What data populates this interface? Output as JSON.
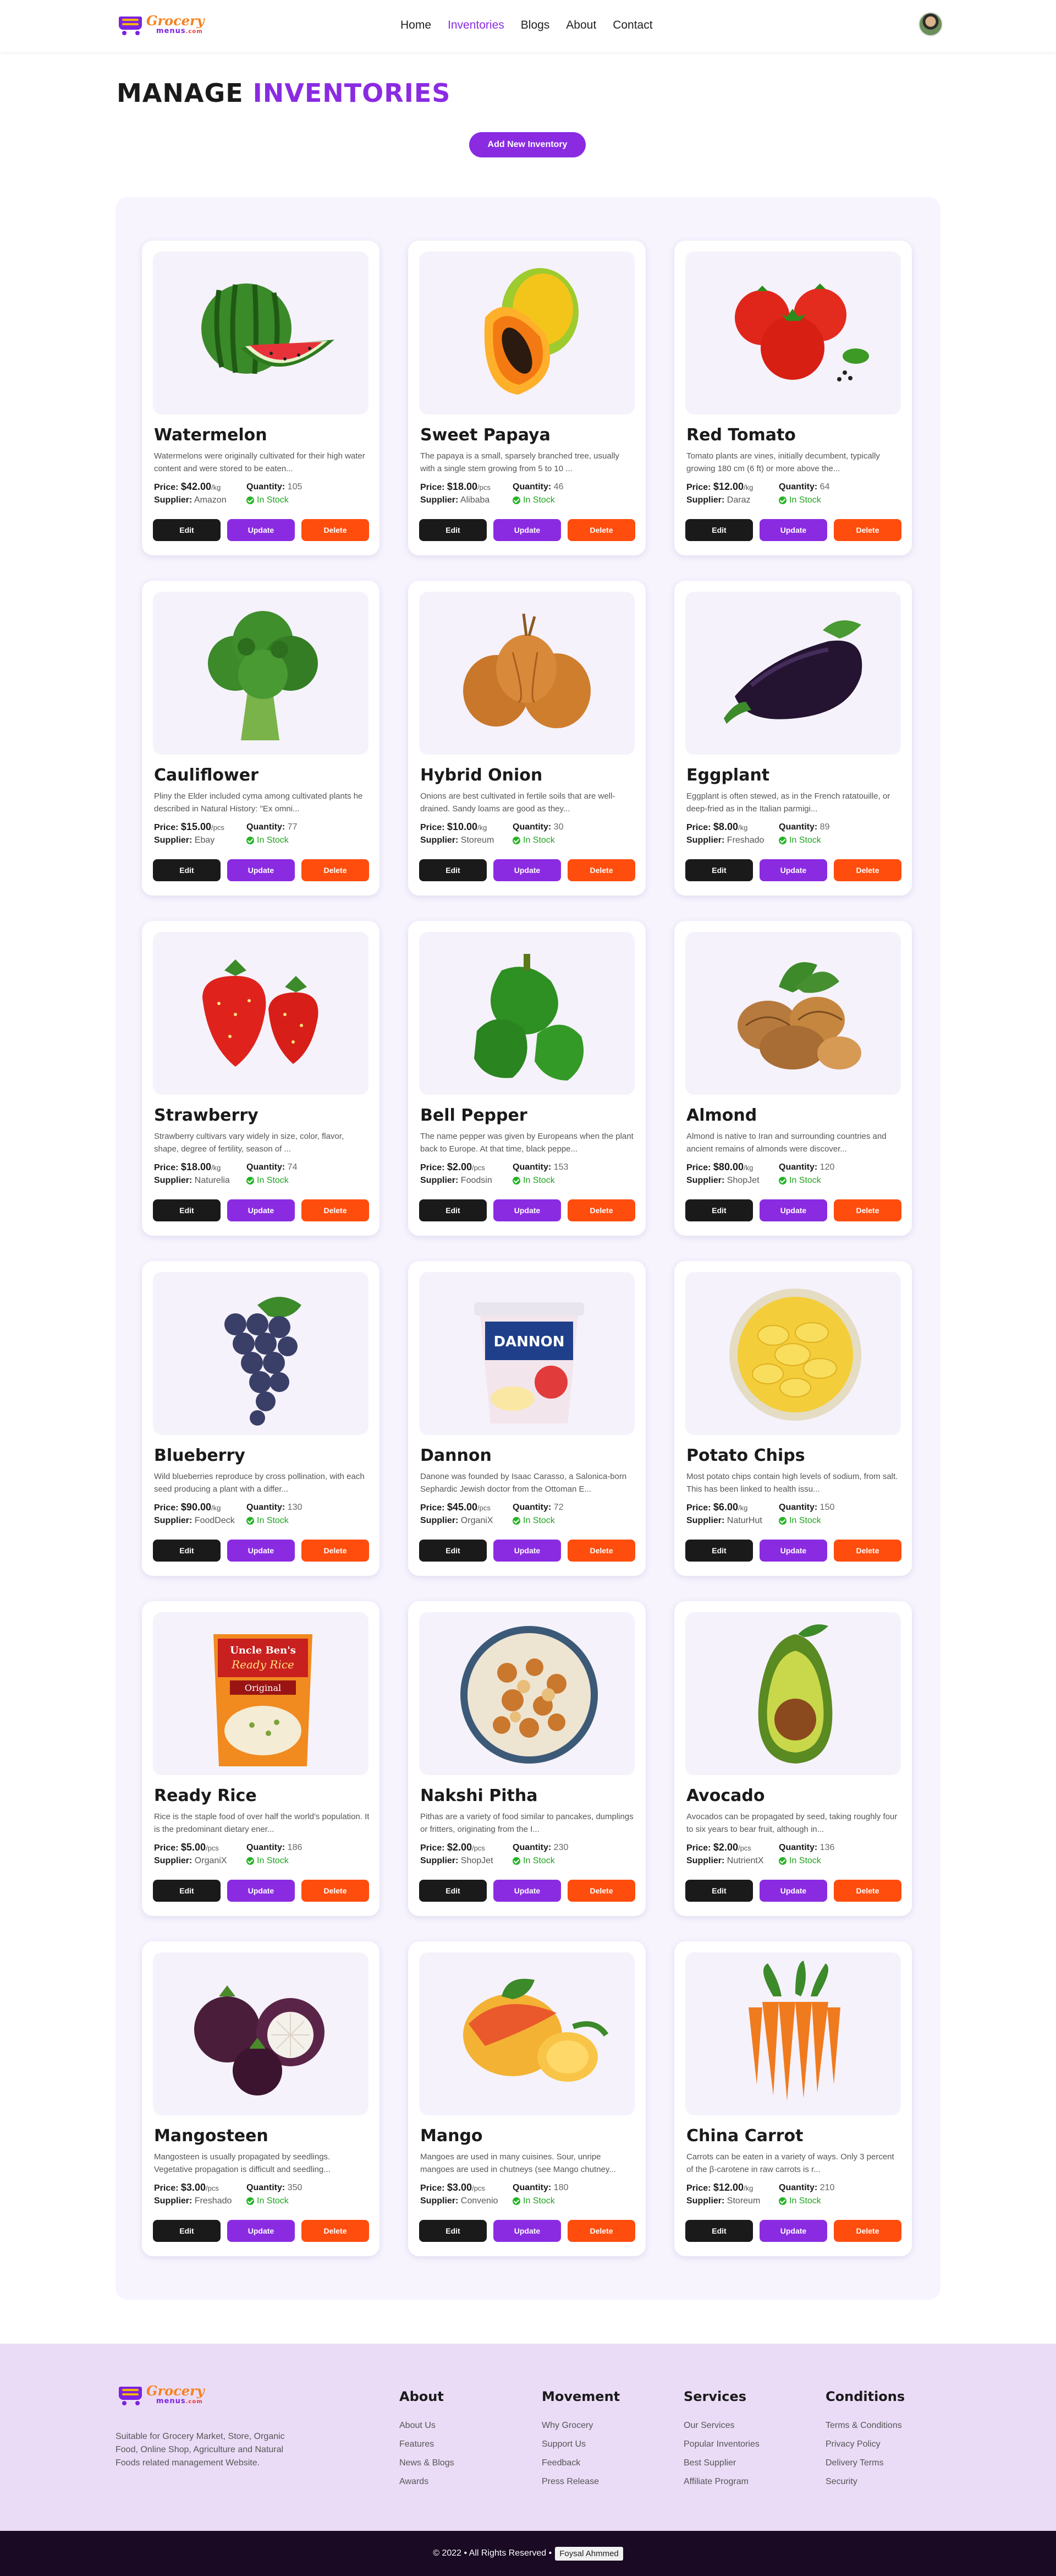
{
  "header": {
    "logo_top": "Grocery",
    "logo_bottom": "menus",
    "logo_suffix": ".com",
    "nav": [
      "Home",
      "Inventories",
      "Blogs",
      "About",
      "Contact"
    ],
    "active_nav": "Inventories"
  },
  "page": {
    "title_part1": "MANAGE",
    "title_part2": "INVENTORIES",
    "add_button": "Add New Inventory"
  },
  "labels": {
    "price": "Price:",
    "quantity": "Quantity:",
    "supplier": "Supplier:",
    "in_stock": "In Stock",
    "edit": "Edit",
    "update": "Update",
    "delete": "Delete"
  },
  "items": [
    {
      "name": "Watermelon",
      "desc": "Watermelons were originally cultivated for their high water content and were stored to be eaten...",
      "price": "$42.00",
      "unit": "/kg",
      "quantity": "105",
      "supplier": "Amazon",
      "icon": "watermelon-icon"
    },
    {
      "name": "Sweet Papaya",
      "desc": "The papaya is a small, sparsely branched tree, usually with a single stem growing from 5 to 10 ...",
      "price": "$18.00",
      "unit": "/pcs",
      "quantity": "46",
      "supplier": "Alibaba",
      "icon": "papaya-icon"
    },
    {
      "name": "Red Tomato",
      "desc": "Tomato plants are vines, initially decumbent, typically growing 180 cm (6 ft) or more above the...",
      "price": "$12.00",
      "unit": "/kg",
      "quantity": "64",
      "supplier": "Daraz",
      "icon": "tomato-icon"
    },
    {
      "name": "Cauliflower",
      "desc": "Pliny the Elder included cyma among cultivated plants he described in Natural History: \"Ex omni...",
      "price": "$15.00",
      "unit": "/pcs",
      "quantity": "77",
      "supplier": "Ebay",
      "icon": "broccoli-icon"
    },
    {
      "name": "Hybrid Onion",
      "desc": "Onions are best cultivated in fertile soils that are well-drained. Sandy loams are good as they...",
      "price": "$10.00",
      "unit": "/kg",
      "quantity": "30",
      "supplier": "Storeum",
      "icon": "onion-icon"
    },
    {
      "name": "Eggplant",
      "desc": "Eggplant is often stewed, as in the French ratatouille, or deep-fried as in the Italian parmigi...",
      "price": "$8.00",
      "unit": "/kg",
      "quantity": "89",
      "supplier": "Freshado",
      "icon": "eggplant-icon"
    },
    {
      "name": "Strawberry",
      "desc": "Strawberry cultivars vary widely in size, color, flavor, shape, degree of fertility, season of ...",
      "price": "$18.00",
      "unit": "/kg",
      "quantity": "74",
      "supplier": "Naturelia",
      "icon": "strawberry-icon"
    },
    {
      "name": "Bell Pepper",
      "desc": "The name pepper was given by Europeans when the plant back to Europe. At that time, black peppe...",
      "price": "$2.00",
      "unit": "/pcs",
      "quantity": "153",
      "supplier": "Foodsin",
      "icon": "pepper-icon"
    },
    {
      "name": "Almond",
      "desc": "Almond is native to Iran and surrounding countries and ancient remains of almonds were discover...",
      "price": "$80.00",
      "unit": "/kg",
      "quantity": "120",
      "supplier": "ShopJet",
      "icon": "walnut-icon"
    },
    {
      "name": "Blueberry",
      "desc": "Wild blueberries reproduce by cross pollination, with each seed producing a plant with a differ...",
      "price": "$90.00",
      "unit": "/kg",
      "quantity": "130",
      "supplier": "FoodDeck",
      "icon": "grapes-icon"
    },
    {
      "name": "Dannon",
      "desc": "Danone was founded by Isaac Carasso, a Salonica-born Sephardic Jewish doctor from the Ottoman E...",
      "price": "$45.00",
      "unit": "/pcs",
      "quantity": "72",
      "supplier": "OrganiX",
      "icon": "yogurt-icon",
      "brand": "DANNON"
    },
    {
      "name": "Potato Chips",
      "desc": "Most potato chips contain high levels of sodium, from salt. This has been linked to health issu...",
      "price": "$6.00",
      "unit": "/kg",
      "quantity": "150",
      "supplier": "NaturHut",
      "icon": "chips-icon"
    },
    {
      "name": "Ready Rice",
      "desc": "Rice is the staple food of over half the world's population. It is the predominant dietary ener...",
      "price": "$5.00",
      "unit": "/pcs",
      "quantity": "186",
      "supplier": "OrganiX",
      "icon": "rice-pack-icon",
      "brand": "Uncle Ben's",
      "brand_sub": "Ready Rice",
      "brand_tag": "Original"
    },
    {
      "name": "Nakshi Pitha",
      "desc": "Pithas are a variety of food similar to pancakes, dumplings or fritters, originating from the I...",
      "price": "$2.00",
      "unit": "/pcs",
      "quantity": "230",
      "supplier": "ShopJet",
      "icon": "snack-bowl-icon"
    },
    {
      "name": "Avocado",
      "desc": "Avocados can be propagated by seed, taking roughly four to six years to bear fruit, although in...",
      "price": "$2.00",
      "unit": "/pcs",
      "quantity": "136",
      "supplier": "NutrientX",
      "icon": "avocado-icon"
    },
    {
      "name": "Mangosteen",
      "desc": "Mangosteen is usually propagated by seedlings. Vegetative propagation is difficult and seedling...",
      "price": "$3.00",
      "unit": "/pcs",
      "quantity": "350",
      "supplier": "Freshado",
      "icon": "mangosteen-icon"
    },
    {
      "name": "Mango",
      "desc": "Mangoes are used in many cuisines. Sour, unripe mangoes are used in chutneys (see Mango chutney...",
      "price": "$3.00",
      "unit": "/pcs",
      "quantity": "180",
      "supplier": "Convenio",
      "icon": "mango-icon"
    },
    {
      "name": "China Carrot",
      "desc": "Carrots can be eaten in a variety of ways. Only 3 percent of the β-carotene in raw carrots is r...",
      "price": "$12.00",
      "unit": "/kg",
      "quantity": "210",
      "supplier": "Storeum",
      "icon": "carrot-icon"
    }
  ],
  "footer": {
    "description": "Suitable for Grocery Market, Store, Organic Food, Online Shop, Agriculture and Natural Foods related management Website.",
    "columns": [
      {
        "title": "About",
        "links": [
          "About Us",
          "Features",
          "News & Blogs",
          "Awards"
        ]
      },
      {
        "title": "Movement",
        "links": [
          "Why Grocery",
          "Support Us",
          "Feedback",
          "Press Release"
        ]
      },
      {
        "title": "Services",
        "links": [
          "Our Services",
          "Popular Inventories",
          "Best Supplier",
          "Affiliate Program"
        ]
      },
      {
        "title": "Conditions",
        "links": [
          "Terms & Conditions",
          "Privacy Policy",
          "Delivery Terms",
          "Security"
        ]
      }
    ],
    "copyright": "© 2022 • All Rights Reserved •",
    "author": "Foysal Ahmmed"
  },
  "colors": {
    "accent": "#8a2be2",
    "delete": "#ff4d0d",
    "edit": "#1a1a1a",
    "stock": "#25b425",
    "footer_bg": "#eadcf7",
    "copyright_bg": "#1a0a24"
  }
}
